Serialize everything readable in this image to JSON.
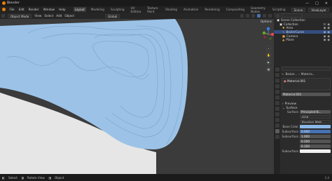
{
  "app": {
    "title": "Blender"
  },
  "window_controls": {
    "minimize": "—",
    "maximize": "□",
    "close": "✕"
  },
  "menu": [
    "File",
    "Edit",
    "Render",
    "Window",
    "Help"
  ],
  "workspaces": [
    "Layout",
    "Modeling",
    "Sculpting",
    "UV Editing",
    "Texture Paint",
    "Shading",
    "Animation",
    "Rendering",
    "Compositing",
    "Geometry Nodes",
    "Scripting"
  ],
  "active_workspace": "Layout",
  "scene": {
    "name": "Scene",
    "view_layer": "ViewLayer"
  },
  "viewport_header": {
    "mode": "Object Mode",
    "menus": [
      "View",
      "Select",
      "Add",
      "Object"
    ],
    "transform": "Global",
    "options_label": "Options"
  },
  "viewport": {
    "gizmo": {
      "x": "X",
      "y": "Y",
      "z": "Z"
    },
    "colors": {
      "background": "#3b3b3b",
      "cloth": "#9cc3e7",
      "cloth_edge": "#7ea6cc",
      "floor": "#e6e6e6",
      "x_axis": "#e8485a",
      "y_axis": "#6fa52c",
      "z_axis": "#3c7ee0"
    }
  },
  "outliner": {
    "title": "Scene Collection",
    "items": [
      {
        "label": "Scene Collection",
        "icon": "collection-icon",
        "selected": false
      },
      {
        "label": "Collection",
        "icon": "collection-icon",
        "selected": false
      },
      {
        "label": "Area",
        "icon": "light-icon",
        "selected": false
      },
      {
        "label": "BezierCurve",
        "icon": "curve-icon",
        "selected": true
      },
      {
        "label": "Camera",
        "icon": "camera-icon",
        "selected": false
      },
      {
        "label": "Plane",
        "icon": "mesh-icon",
        "selected": false
      }
    ]
  },
  "properties": {
    "breadcrumb": [
      "Bezier...",
      "Materia..."
    ],
    "slot": "Material.001",
    "material_name": "Material.001",
    "preview_label": "Preview",
    "surface_section": "Surface",
    "surface_value": "Principled B...",
    "rows": [
      {
        "label": "",
        "value": "GGX"
      },
      {
        "label": "",
        "value": "Random Walk"
      },
      {
        "label": "Base Color",
        "value": ""
      },
      {
        "label": "Subsurface",
        "value": "0.000"
      },
      {
        "label": "Subsurface",
        "value": "1.000"
      },
      {
        "label": "",
        "value": "0.200"
      },
      {
        "label": "",
        "value": "0.100"
      },
      {
        "label": "Subsurface",
        "value": ""
      }
    ],
    "base_color": "#8cb8e8"
  },
  "statusbar": {
    "items": [
      "Select",
      "Rotate View",
      "Object"
    ],
    "version": "3.4"
  }
}
